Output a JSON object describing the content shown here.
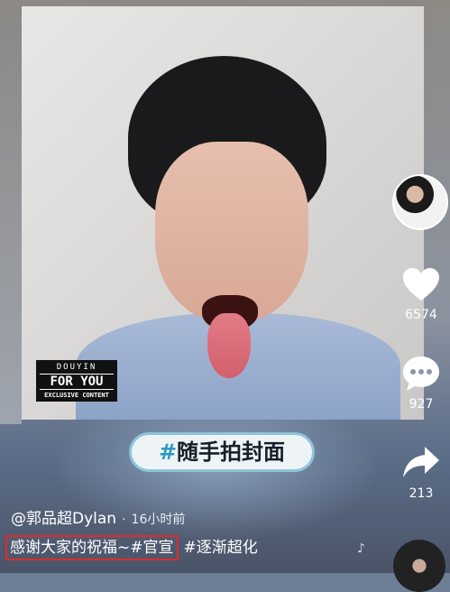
{
  "video": {
    "watermark": {
      "line1": "DOUYIN",
      "line2": "FOR YOU",
      "line3": "EXCLUSIVE CONTENT"
    },
    "cover_tag": {
      "hash": "#",
      "label": "随手拍封面"
    }
  },
  "sidebar": {
    "likes": "6574",
    "comments": "927",
    "shares": "213"
  },
  "post": {
    "author": "@郭品超Dylan",
    "separator": "·",
    "time": "16小时前",
    "caption_highlighted": "感谢大家的祝福~#官宣",
    "caption_tag": "#逐渐超化"
  },
  "colors": {
    "highlight_box": "#e22a2a",
    "cover_tag_hash": "#2a9bc0"
  },
  "icons": [
    "heart-icon",
    "comment-icon",
    "share-icon",
    "music-note-icon"
  ]
}
